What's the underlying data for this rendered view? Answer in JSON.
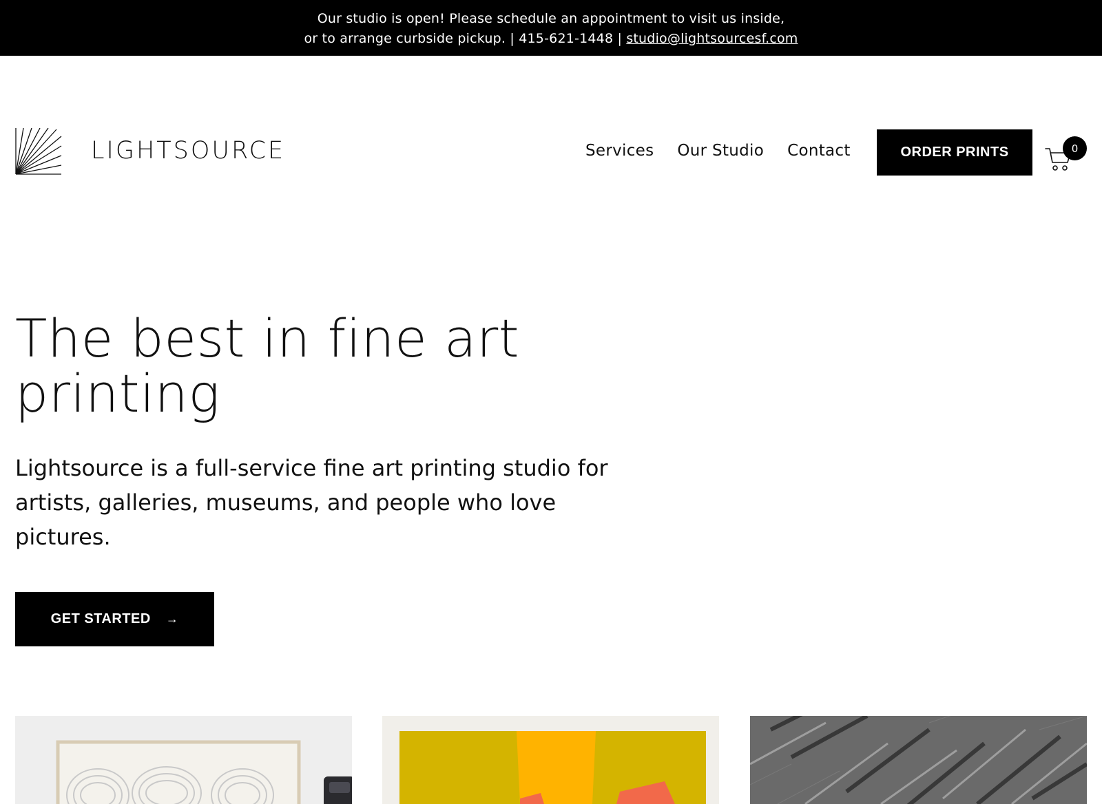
{
  "announcement": {
    "line1": "Our studio is open! Please schedule an appointment to visit us inside,",
    "line2_text": "or to arrange curbside pickup. | 415-621-1448 | ",
    "email": "studio@lightsourcesf.com"
  },
  "header": {
    "logo_text": "LIGHTSOURCE",
    "nav": [
      "Services",
      "Our Studio",
      "Contact"
    ],
    "order_button": "ORDER PRINTS",
    "cart_count": "0"
  },
  "hero": {
    "title_line1": "The best in fine art",
    "title_line2": "printing",
    "subtitle": "Lightsource is a full-service fine art printing studio for artists, galleries, museums, and people who love pictures.",
    "cta_label": "GET STARTED",
    "cta_arrow": "→"
  },
  "colors": {
    "black": "#000000",
    "white": "#ffffff",
    "mustard": "#d4b400",
    "orange": "#ffb300",
    "coral": "#f2694a"
  },
  "icons": [
    "logo-sunburst-icon",
    "cart-icon",
    "arrow-right-icon"
  ]
}
